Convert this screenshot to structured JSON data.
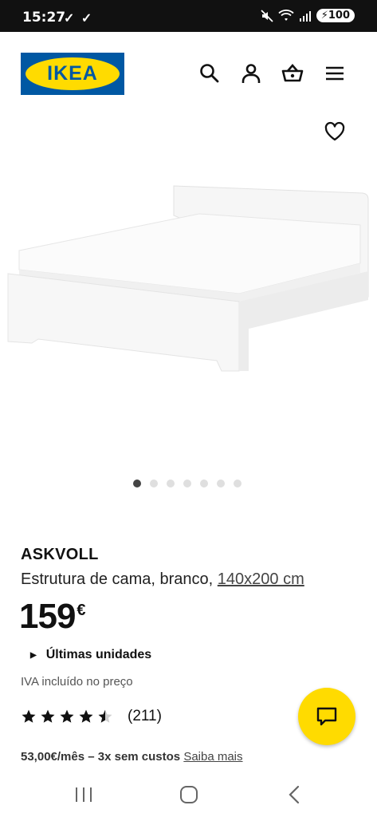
{
  "status_bar": {
    "time": "15:27",
    "checks": "✓ ✓",
    "battery": "100"
  },
  "header": {
    "logo_text": "IKEA",
    "icons": [
      "search-icon",
      "user-icon",
      "basket-icon",
      "menu-icon"
    ]
  },
  "gallery": {
    "dot_count": 7,
    "active_index": 0
  },
  "product": {
    "name": "ASKVOLL",
    "description": "Estrutura de cama, branco,",
    "size": "140x200 cm",
    "price": "159",
    "currency": "€",
    "stock": "Últimas unidades",
    "vat_note": "IVA incluído no preço",
    "rating": 4.5,
    "review_count": "(211)",
    "finance_text": "53,00€/mês – 3x sem custos",
    "finance_link": "Saiba mais"
  },
  "colors": {
    "brand_blue": "#0058a3",
    "brand_yellow": "#ffdb00"
  }
}
